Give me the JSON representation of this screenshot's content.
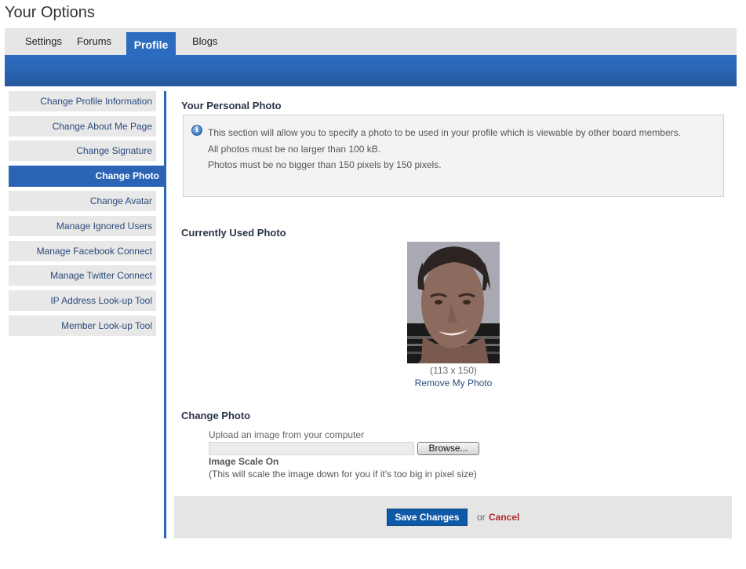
{
  "page": {
    "title": "Your Options"
  },
  "nav": {
    "tabs": [
      {
        "label": "Settings",
        "active": false
      },
      {
        "label": "Forums",
        "active": false
      },
      {
        "label": "Profile",
        "active": true
      },
      {
        "label": "Blogs",
        "active": false
      }
    ]
  },
  "sidebar": {
    "items": [
      {
        "label": "Change Profile Information",
        "active": false
      },
      {
        "label": "Change About Me Page",
        "active": false
      },
      {
        "label": "Change Signature",
        "active": false
      },
      {
        "label": "Change Photo",
        "active": true
      },
      {
        "label": "Change Avatar",
        "active": false
      },
      {
        "label": "Manage Ignored Users",
        "active": false
      },
      {
        "label": "Manage Facebook Connect",
        "active": false
      },
      {
        "label": "Manage Twitter Connect",
        "active": false
      },
      {
        "label": "IP Address Look-up Tool",
        "active": false
      },
      {
        "label": "Member Look-up Tool",
        "active": false
      }
    ]
  },
  "personal_photo": {
    "title": "Your Personal Photo",
    "info_icon": "info-icon",
    "info_lines": [
      "This section will allow you to specify a photo to be used in your profile which is viewable by other board members.",
      "All photos must be no larger than 100 kB.",
      "Photos must be no bigger than 150 pixels by 150 pixels."
    ]
  },
  "current_photo": {
    "title": "Currently Used Photo",
    "dimensions": "(113 x 150)",
    "remove_label": "Remove My Photo"
  },
  "change_photo": {
    "title": "Change Photo",
    "upload_label": "Upload an image from your computer",
    "file_value": "",
    "browse_label": "Browse...",
    "scale_title": "Image Scale On",
    "scale_desc": "(This will scale the image down for you if it's too big in pixel size)"
  },
  "footer": {
    "save_label": "Save Changes",
    "or_text": "or",
    "cancel_label": "Cancel"
  },
  "colors": {
    "accent_blue": "#2b6cbf",
    "save_button": "#0f5aa8",
    "cancel_red": "#b02a2a"
  }
}
